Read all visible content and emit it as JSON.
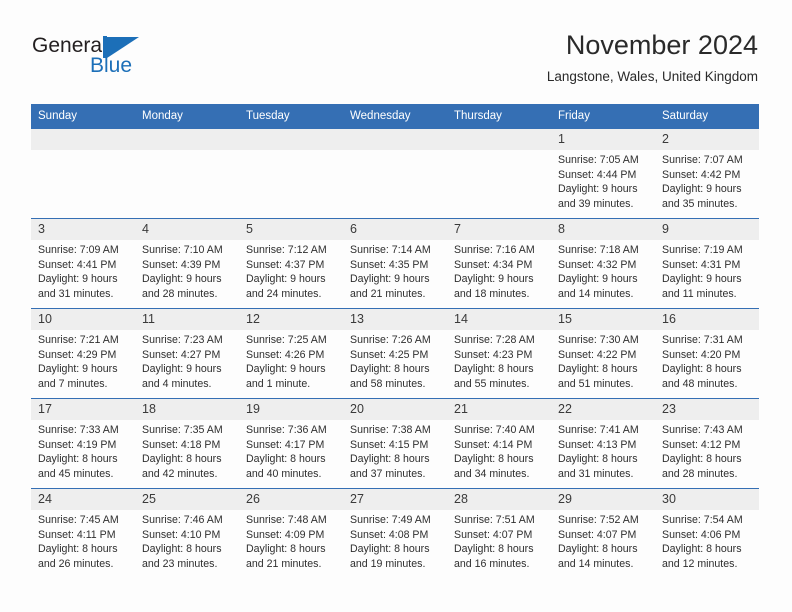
{
  "logo": {
    "word1": "General",
    "word2": "Blue",
    "mark_icon": "general-blue-sail-logo-icon",
    "brand_blue": "#1c6fb8",
    "brand_dark": "#231f20"
  },
  "header": {
    "month_title": "November 2024",
    "location": "Langstone, Wales, United Kingdom",
    "accent_color": "#356fb4",
    "daynum_bg": "#eeeeee"
  },
  "calendar": {
    "weekdays": [
      "Sunday",
      "Monday",
      "Tuesday",
      "Wednesday",
      "Thursday",
      "Friday",
      "Saturday"
    ],
    "labels": {
      "sunrise": "Sunrise:",
      "sunset": "Sunset:",
      "daylight": "Daylight:"
    },
    "weeks": [
      [
        {
          "day": ""
        },
        {
          "day": ""
        },
        {
          "day": ""
        },
        {
          "day": ""
        },
        {
          "day": ""
        },
        {
          "day": "1",
          "sunrise": "Sunrise: 7:05 AM",
          "sunset": "Sunset: 4:44 PM",
          "daylight_1": "Daylight: 9 hours",
          "daylight_2": "and 39 minutes."
        },
        {
          "day": "2",
          "sunrise": "Sunrise: 7:07 AM",
          "sunset": "Sunset: 4:42 PM",
          "daylight_1": "Daylight: 9 hours",
          "daylight_2": "and 35 minutes."
        }
      ],
      [
        {
          "day": "3",
          "sunrise": "Sunrise: 7:09 AM",
          "sunset": "Sunset: 4:41 PM",
          "daylight_1": "Daylight: 9 hours",
          "daylight_2": "and 31 minutes."
        },
        {
          "day": "4",
          "sunrise": "Sunrise: 7:10 AM",
          "sunset": "Sunset: 4:39 PM",
          "daylight_1": "Daylight: 9 hours",
          "daylight_2": "and 28 minutes."
        },
        {
          "day": "5",
          "sunrise": "Sunrise: 7:12 AM",
          "sunset": "Sunset: 4:37 PM",
          "daylight_1": "Daylight: 9 hours",
          "daylight_2": "and 24 minutes."
        },
        {
          "day": "6",
          "sunrise": "Sunrise: 7:14 AM",
          "sunset": "Sunset: 4:35 PM",
          "daylight_1": "Daylight: 9 hours",
          "daylight_2": "and 21 minutes."
        },
        {
          "day": "7",
          "sunrise": "Sunrise: 7:16 AM",
          "sunset": "Sunset: 4:34 PM",
          "daylight_1": "Daylight: 9 hours",
          "daylight_2": "and 18 minutes."
        },
        {
          "day": "8",
          "sunrise": "Sunrise: 7:18 AM",
          "sunset": "Sunset: 4:32 PM",
          "daylight_1": "Daylight: 9 hours",
          "daylight_2": "and 14 minutes."
        },
        {
          "day": "9",
          "sunrise": "Sunrise: 7:19 AM",
          "sunset": "Sunset: 4:31 PM",
          "daylight_1": "Daylight: 9 hours",
          "daylight_2": "and 11 minutes."
        }
      ],
      [
        {
          "day": "10",
          "sunrise": "Sunrise: 7:21 AM",
          "sunset": "Sunset: 4:29 PM",
          "daylight_1": "Daylight: 9 hours",
          "daylight_2": "and 7 minutes."
        },
        {
          "day": "11",
          "sunrise": "Sunrise: 7:23 AM",
          "sunset": "Sunset: 4:27 PM",
          "daylight_1": "Daylight: 9 hours",
          "daylight_2": "and 4 minutes."
        },
        {
          "day": "12",
          "sunrise": "Sunrise: 7:25 AM",
          "sunset": "Sunset: 4:26 PM",
          "daylight_1": "Daylight: 9 hours",
          "daylight_2": "and 1 minute."
        },
        {
          "day": "13",
          "sunrise": "Sunrise: 7:26 AM",
          "sunset": "Sunset: 4:25 PM",
          "daylight_1": "Daylight: 8 hours",
          "daylight_2": "and 58 minutes."
        },
        {
          "day": "14",
          "sunrise": "Sunrise: 7:28 AM",
          "sunset": "Sunset: 4:23 PM",
          "daylight_1": "Daylight: 8 hours",
          "daylight_2": "and 55 minutes."
        },
        {
          "day": "15",
          "sunrise": "Sunrise: 7:30 AM",
          "sunset": "Sunset: 4:22 PM",
          "daylight_1": "Daylight: 8 hours",
          "daylight_2": "and 51 minutes."
        },
        {
          "day": "16",
          "sunrise": "Sunrise: 7:31 AM",
          "sunset": "Sunset: 4:20 PM",
          "daylight_1": "Daylight: 8 hours",
          "daylight_2": "and 48 minutes."
        }
      ],
      [
        {
          "day": "17",
          "sunrise": "Sunrise: 7:33 AM",
          "sunset": "Sunset: 4:19 PM",
          "daylight_1": "Daylight: 8 hours",
          "daylight_2": "and 45 minutes."
        },
        {
          "day": "18",
          "sunrise": "Sunrise: 7:35 AM",
          "sunset": "Sunset: 4:18 PM",
          "daylight_1": "Daylight: 8 hours",
          "daylight_2": "and 42 minutes."
        },
        {
          "day": "19",
          "sunrise": "Sunrise: 7:36 AM",
          "sunset": "Sunset: 4:17 PM",
          "daylight_1": "Daylight: 8 hours",
          "daylight_2": "and 40 minutes."
        },
        {
          "day": "20",
          "sunrise": "Sunrise: 7:38 AM",
          "sunset": "Sunset: 4:15 PM",
          "daylight_1": "Daylight: 8 hours",
          "daylight_2": "and 37 minutes."
        },
        {
          "day": "21",
          "sunrise": "Sunrise: 7:40 AM",
          "sunset": "Sunset: 4:14 PM",
          "daylight_1": "Daylight: 8 hours",
          "daylight_2": "and 34 minutes."
        },
        {
          "day": "22",
          "sunrise": "Sunrise: 7:41 AM",
          "sunset": "Sunset: 4:13 PM",
          "daylight_1": "Daylight: 8 hours",
          "daylight_2": "and 31 minutes."
        },
        {
          "day": "23",
          "sunrise": "Sunrise: 7:43 AM",
          "sunset": "Sunset: 4:12 PM",
          "daylight_1": "Daylight: 8 hours",
          "daylight_2": "and 28 minutes."
        }
      ],
      [
        {
          "day": "24",
          "sunrise": "Sunrise: 7:45 AM",
          "sunset": "Sunset: 4:11 PM",
          "daylight_1": "Daylight: 8 hours",
          "daylight_2": "and 26 minutes."
        },
        {
          "day": "25",
          "sunrise": "Sunrise: 7:46 AM",
          "sunset": "Sunset: 4:10 PM",
          "daylight_1": "Daylight: 8 hours",
          "daylight_2": "and 23 minutes."
        },
        {
          "day": "26",
          "sunrise": "Sunrise: 7:48 AM",
          "sunset": "Sunset: 4:09 PM",
          "daylight_1": "Daylight: 8 hours",
          "daylight_2": "and 21 minutes."
        },
        {
          "day": "27",
          "sunrise": "Sunrise: 7:49 AM",
          "sunset": "Sunset: 4:08 PM",
          "daylight_1": "Daylight: 8 hours",
          "daylight_2": "and 19 minutes."
        },
        {
          "day": "28",
          "sunrise": "Sunrise: 7:51 AM",
          "sunset": "Sunset: 4:07 PM",
          "daylight_1": "Daylight: 8 hours",
          "daylight_2": "and 16 minutes."
        },
        {
          "day": "29",
          "sunrise": "Sunrise: 7:52 AM",
          "sunset": "Sunset: 4:07 PM",
          "daylight_1": "Daylight: 8 hours",
          "daylight_2": "and 14 minutes."
        },
        {
          "day": "30",
          "sunrise": "Sunrise: 7:54 AM",
          "sunset": "Sunset: 4:06 PM",
          "daylight_1": "Daylight: 8 hours",
          "daylight_2": "and 12 minutes."
        }
      ]
    ]
  }
}
